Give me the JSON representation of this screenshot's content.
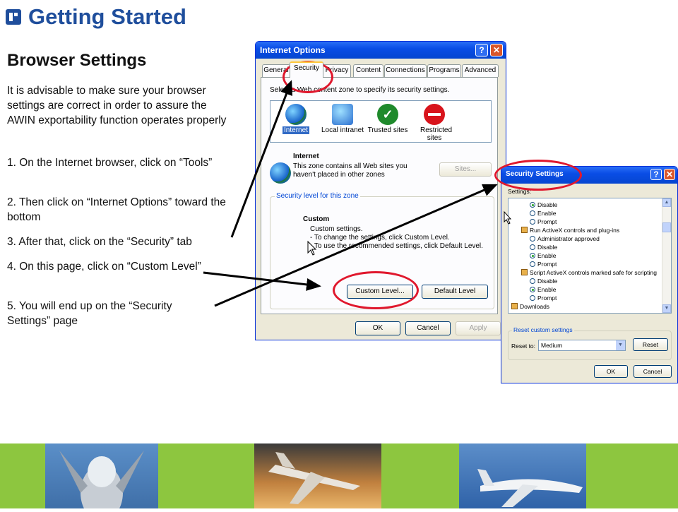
{
  "slide": {
    "title": "Getting Started",
    "subtitle": "Browser Settings",
    "intro": "It is advisable to make sure your browser settings are correct in order to assure the AWIN exportability function operates properly",
    "steps": [
      "1. On the Internet browser, click on “Tools”",
      "2. Then click on “Internet Options” toward the bottom",
      "3. After that, click on the “Security” tab",
      "4. On this page, click on “Custom Level”",
      "5. You will end up on the “Security Settings” page"
    ],
    "accent_color": "#1f4e9c",
    "banner_color": "#8dc63f",
    "highlight_color": "#e0182d"
  },
  "internet_options": {
    "title": "Internet Options",
    "tabs": [
      "General",
      "Security",
      "Privacy",
      "Content",
      "Connections",
      "Programs",
      "Advanced"
    ],
    "active_tab": "Security",
    "zone_prompt": "Select a Web content zone to specify its security settings.",
    "zones": [
      {
        "label": "Internet",
        "icon": "globe-icon"
      },
      {
        "label": "Local intranet",
        "icon": "network-icon"
      },
      {
        "label": "Trusted sites",
        "icon": "checkmark-icon"
      },
      {
        "label": "Restricted sites",
        "icon": "no-entry-icon"
      }
    ],
    "zone_heading": "Internet",
    "zone_description": "This zone contains all Web sites you haven't placed in other zones",
    "sites_button": "Sites...",
    "security_level_label": "Security level for this zone",
    "level_heading": "Custom",
    "level_desc_1": "Custom settings.",
    "level_desc_2": "- To change the settings, click Custom Level.",
    "level_desc_3": "- To use the recommended settings, click Default Level.",
    "custom_level_button": "Custom Level...",
    "default_level_button": "Default Level",
    "ok_button": "OK",
    "cancel_button": "Cancel",
    "apply_button": "Apply"
  },
  "security_settings": {
    "title": "Security Settings",
    "settings_label": "Settings:",
    "rows": [
      {
        "type": "radio",
        "label": "Disable",
        "checked": true
      },
      {
        "type": "radio",
        "label": "Enable",
        "checked": false
      },
      {
        "type": "radio",
        "label": "Prompt",
        "checked": false
      },
      {
        "type": "category",
        "label": "Run ActiveX controls and plug-ins"
      },
      {
        "type": "radio",
        "label": "Administrator approved",
        "checked": false
      },
      {
        "type": "radio",
        "label": "Disable",
        "checked": false
      },
      {
        "type": "radio",
        "label": "Enable",
        "checked": true
      },
      {
        "type": "radio",
        "label": "Prompt",
        "checked": false
      },
      {
        "type": "category",
        "label": "Script ActiveX controls marked safe for scripting"
      },
      {
        "type": "radio",
        "label": "Disable",
        "checked": false
      },
      {
        "type": "radio",
        "label": "Enable",
        "checked": true
      },
      {
        "type": "radio",
        "label": "Prompt",
        "checked": false
      },
      {
        "type": "category",
        "label": "Downloads"
      }
    ],
    "reset_group_label": "Reset custom settings",
    "reset_to_label": "Reset to:",
    "reset_value": "Medium",
    "reset_button": "Reset",
    "ok_button": "OK",
    "cancel_button": "Cancel"
  }
}
